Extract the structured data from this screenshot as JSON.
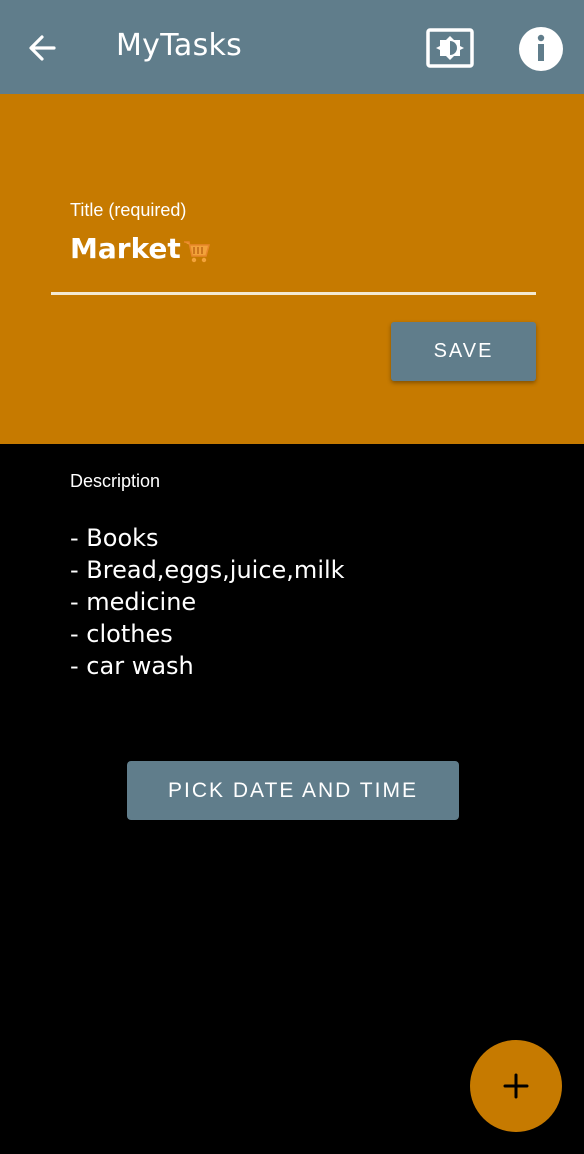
{
  "appbar": {
    "title": "MyTasks",
    "back_icon": "arrow-left-icon",
    "brightness_icon": "brightness-icon",
    "info_icon": "info-icon",
    "color": "#607d8b"
  },
  "title_field": {
    "label": "Title (required)",
    "value": "Market",
    "emoji_icon": "shopping-cart-icon",
    "panel_color": "#c67a00"
  },
  "save_button": {
    "label": "SAVE"
  },
  "description": {
    "label": "Description",
    "lines": [
      "- Books",
      "- Bread,eggs,juice,milk",
      "- medicine",
      "- clothes",
      "- car wash"
    ]
  },
  "pick_button": {
    "label": "PICK DATE AND TIME"
  },
  "fab": {
    "icon": "plus-icon",
    "color": "#c67a00"
  }
}
